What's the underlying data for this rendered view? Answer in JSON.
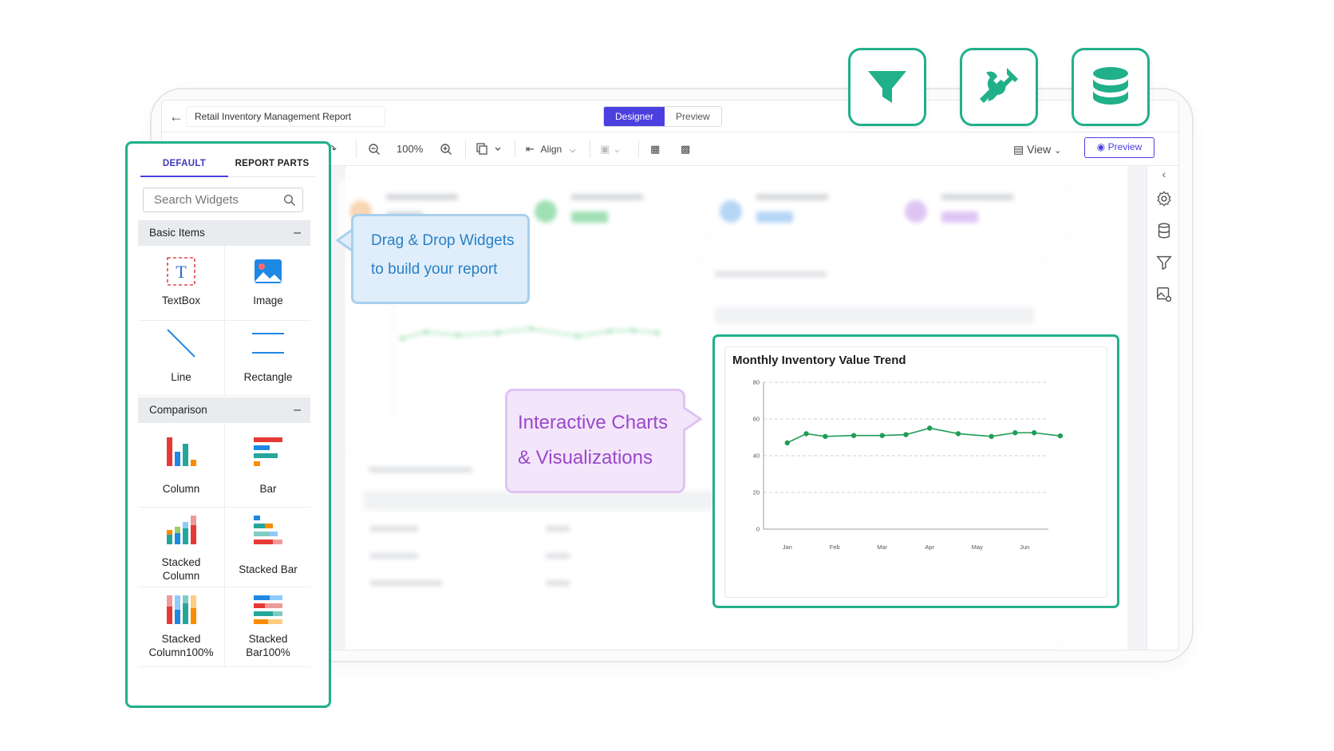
{
  "app": {
    "report_title": "Retail Inventory Management Report",
    "mode_designer": "Designer",
    "mode_preview": "Preview"
  },
  "toolbar": {
    "zoom": "100%",
    "align_label": "Align",
    "view_label": "View",
    "preview_label": "Preview"
  },
  "widget_panel": {
    "tab_default": "DEFAULT",
    "tab_report_parts": "REPORT PARTS",
    "search_placeholder": "Search Widgets",
    "group_basic": "Basic Items",
    "group_comparison": "Comparison",
    "basic_items": [
      "TextBox",
      "Image",
      "Line",
      "Rectangle"
    ],
    "comparison_items": [
      "Column",
      "Bar",
      "Stacked\nColumn",
      "Stacked Bar",
      "Stacked\nColumn100%",
      "Stacked\nBar100%"
    ]
  },
  "callouts": {
    "drag_line1": "Drag & Drop Widgets",
    "drag_line2": "to build your report",
    "charts_line1": "Interactive Charts",
    "charts_line2": "& Visualizations"
  },
  "feature_tiles": [
    "funnel-icon",
    "tools-icon",
    "database-icon"
  ],
  "colors": {
    "accent_green": "#20b08a",
    "designer_blue": "#4b3fe0",
    "line_green": "#1e9e55"
  },
  "chart_data": {
    "type": "line",
    "title": "Monthly Inventory Value Trend",
    "categories": [
      "Jan",
      "Feb",
      "Mar",
      "Apr",
      "May",
      "Jun"
    ],
    "x": [
      0.0,
      0.4,
      0.8,
      1.4,
      2.0,
      2.5,
      3.0,
      3.6,
      4.3,
      4.8,
      5.2,
      5.75
    ],
    "values": [
      47,
      52,
      50.5,
      51,
      51,
      51.5,
      55,
      52,
      50.5,
      52.5,
      52.5,
      50.8
    ],
    "ylim": [
      0,
      80
    ],
    "yticks": [
      0,
      20,
      40,
      60,
      80
    ],
    "grid": true
  }
}
